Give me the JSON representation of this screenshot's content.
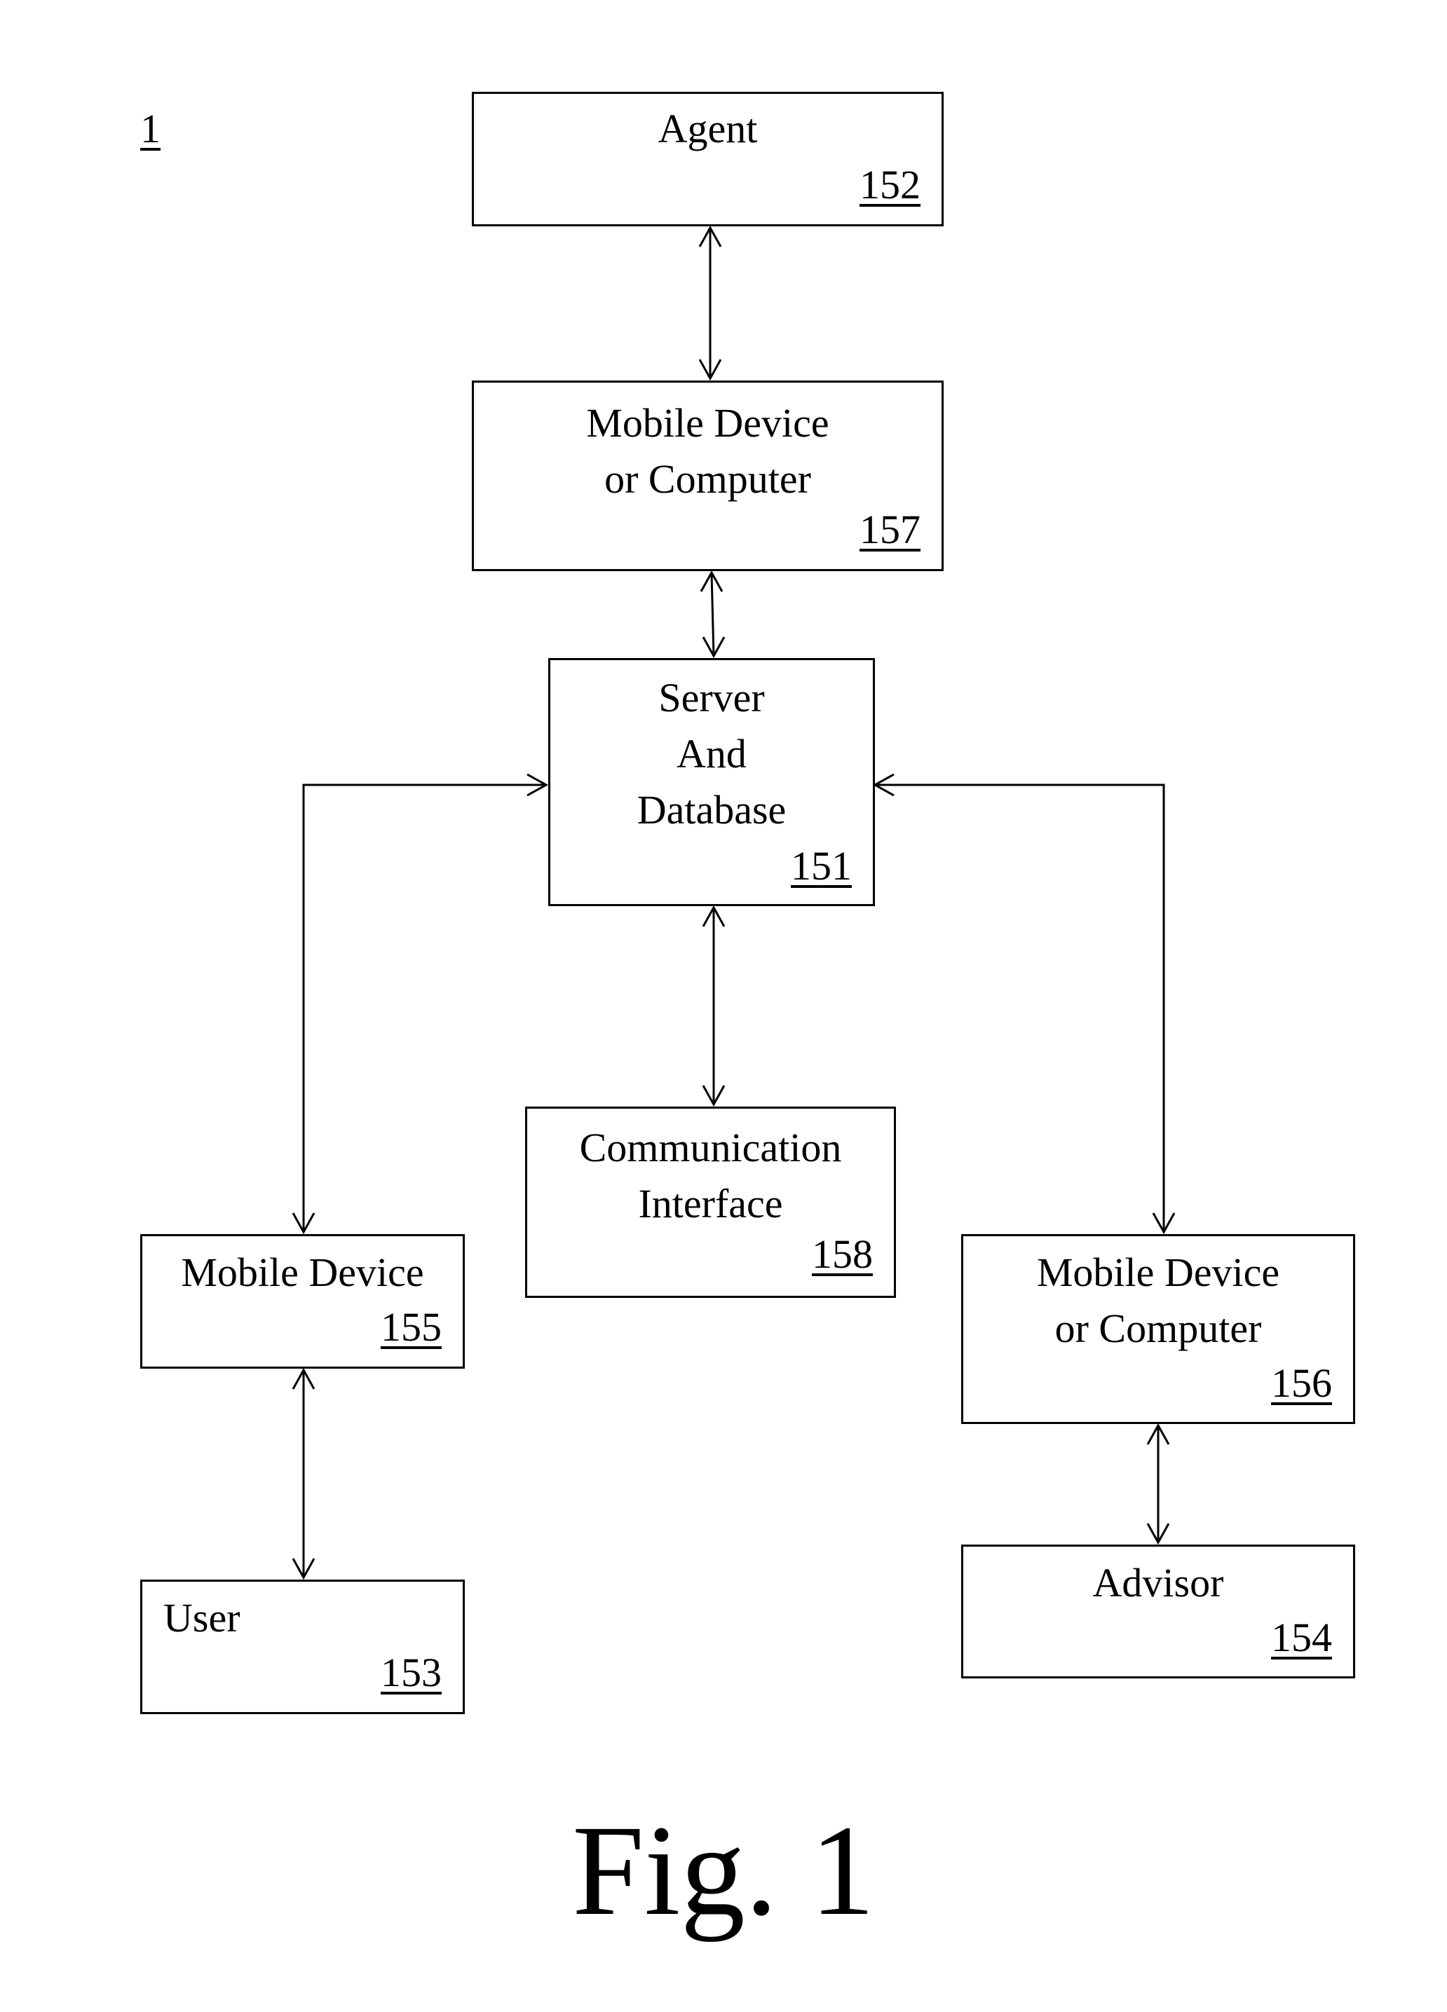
{
  "figure": {
    "reference_numeral": "1",
    "caption": "Fig. 1"
  },
  "blocks": {
    "agent": {
      "title": "Agent",
      "ref": "152"
    },
    "agent_device": {
      "title": "Mobile Device\nor Computer",
      "ref": "157"
    },
    "server": {
      "title": "Server\nAnd\nDatabase",
      "ref": "151"
    },
    "communication_interface": {
      "title": "Communication\nInterface",
      "ref": "158"
    },
    "user_device": {
      "title": "Mobile Device",
      "ref": "155"
    },
    "advisor_device": {
      "title": "Mobile Device\nor Computer",
      "ref": "156"
    },
    "user": {
      "title": "User",
      "ref": "153"
    },
    "advisor": {
      "title": "Advisor",
      "ref": "154"
    }
  },
  "connections": [
    {
      "from": "agent",
      "to": "agent_device",
      "type": "bidirectional"
    },
    {
      "from": "agent_device",
      "to": "server",
      "type": "bidirectional"
    },
    {
      "from": "server",
      "to": "communication_interface",
      "type": "bidirectional"
    },
    {
      "from": "server",
      "to": "user_device",
      "type": "bidirectional"
    },
    {
      "from": "server",
      "to": "advisor_device",
      "type": "bidirectional"
    },
    {
      "from": "user_device",
      "to": "user",
      "type": "bidirectional"
    },
    {
      "from": "advisor_device",
      "to": "advisor",
      "type": "bidirectional"
    }
  ]
}
